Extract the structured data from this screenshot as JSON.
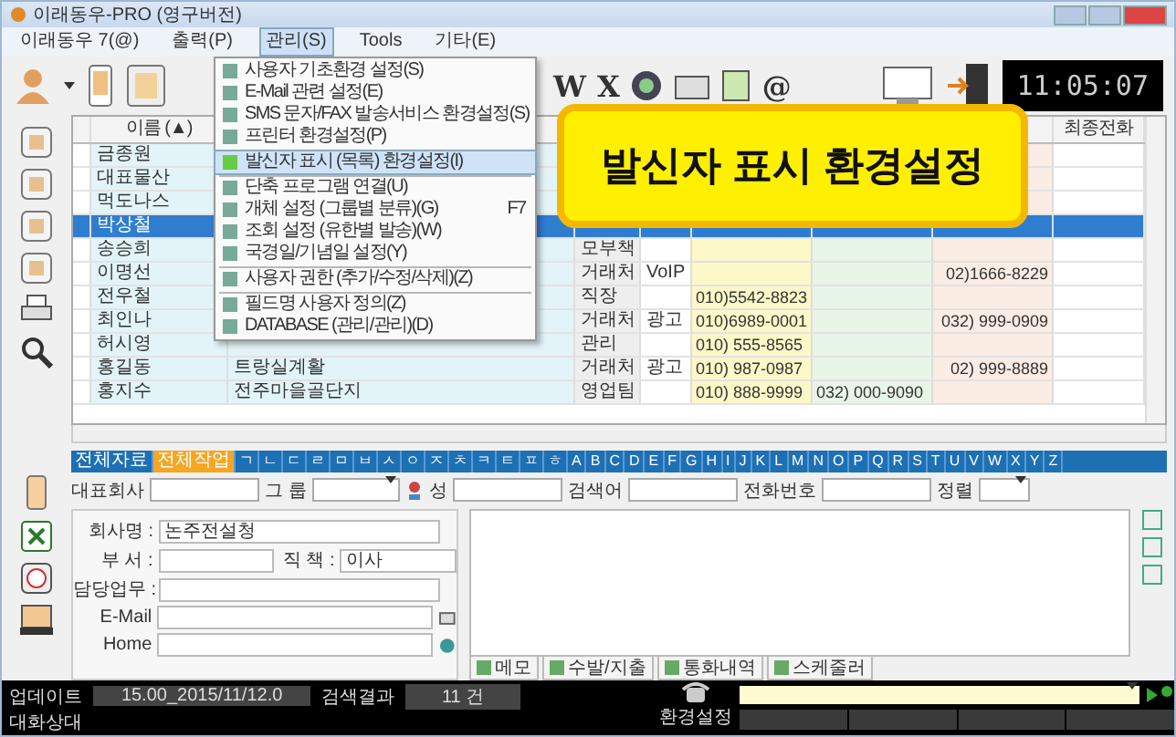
{
  "window": {
    "title": "이래동우-PRO (영구버전)"
  },
  "menu_bar": [
    {
      "label": "이래동우 7(@)",
      "selected": false
    },
    {
      "label": "출력(P)",
      "selected": false
    },
    {
      "label": "관리(S)",
      "selected": true
    },
    {
      "label": "Tools",
      "selected": false
    },
    {
      "label": "기타(E)",
      "selected": false
    }
  ],
  "toolbar": {
    "letters": [
      "W",
      "X"
    ],
    "at": "@",
    "clock": "11:05:07"
  },
  "dropdown": [
    {
      "label": "사용자 기초환경 설정(S)",
      "selected": false
    },
    {
      "label": "E-Mail 관련 설정(E)",
      "selected": false
    },
    {
      "label": "SMS 문자/FAX 발송서비스 환경설정(S)",
      "selected": false
    },
    {
      "label": "프린터 환경설정(P)",
      "selected": false,
      "separator_after": true
    },
    {
      "label": "발신자 표시 (목록) 환경설정(I)",
      "selected": true,
      "separator_after": true
    },
    {
      "label": "단축 프로그램 연결(U)",
      "selected": false
    },
    {
      "label": "개체 설정 (그룹별 분류)(G)",
      "shortcut": "F7",
      "selected": false
    },
    {
      "label": "조회 설정 (유한별 발송)(W)",
      "selected": false
    },
    {
      "label": "국경일/기념일 설정(Y)",
      "selected": false,
      "separator_after": true
    },
    {
      "label": "사용자 권한 (추가/수정/삭제)(Z)",
      "selected": false,
      "separator_after": true
    },
    {
      "label": "필드명 사용자 정의(Z)",
      "selected": false
    },
    {
      "label": "DATABASE (관리/관리)(D)",
      "selected": false
    }
  ],
  "callout": "발신자 표시 환경설정",
  "table": {
    "name_header": "이름 (▲)",
    "last_header": "최종전화",
    "rows": [
      {
        "name": "금종원",
        "selected": false
      },
      {
        "name": "대표물산",
        "selected": false
      },
      {
        "name": "먹도나스",
        "selected": false
      },
      {
        "name": "박상철",
        "selected": true
      },
      {
        "name": "송승희",
        "position": "모부책",
        "selected": false
      },
      {
        "name": "이명선",
        "position": "거래처",
        "type": "VoIP",
        "office": "02)1666-8229",
        "selected": false
      },
      {
        "name": "전우철",
        "position": "직장",
        "mobile": "010)5542-8823",
        "selected": false
      },
      {
        "name": "최인나",
        "position": "거래처",
        "type": "광고",
        "mobile": "010)6989-0001",
        "office": "032) 999-0909",
        "selected": false
      },
      {
        "name": "허시영",
        "position": "관리",
        "mobile": "010) 555-8565",
        "selected": false
      },
      {
        "name": "홍길동",
        "company": "트랑실계활",
        "position": "거래처",
        "type": "광고",
        "mobile": "010) 987-0987",
        "office": "02) 999-8889",
        "selected": false
      },
      {
        "name": "홍지수",
        "company": "전주마을골단지",
        "position": "영업팀",
        "mobile": "010) 888-9999",
        "phone2": "032) 000-9090",
        "selected": false
      }
    ]
  },
  "index_bar": [
    {
      "label": "전체자료",
      "selected": false
    },
    {
      "label": "전체작업",
      "selected": true
    },
    {
      "label": "ㄱ",
      "selected": false
    },
    {
      "label": "ㄴ",
      "selected": false
    },
    {
      "label": "ㄷ",
      "selected": false
    },
    {
      "label": "ㄹ",
      "selected": false
    },
    {
      "label": "ㅁ",
      "selected": false
    },
    {
      "label": "ㅂ",
      "selected": false
    },
    {
      "label": "ㅅ",
      "selected": false
    },
    {
      "label": "ㅇ",
      "selected": false
    },
    {
      "label": "ㅈ",
      "selected": false
    },
    {
      "label": "ㅊ",
      "selected": false
    },
    {
      "label": "ㅋ",
      "selected": false
    },
    {
      "label": "ㅌ",
      "selected": false
    },
    {
      "label": "ㅍ",
      "selected": false
    },
    {
      "label": "ㅎ",
      "selected": false
    },
    {
      "label": "A",
      "selected": false
    },
    {
      "label": "B",
      "selected": false
    },
    {
      "label": "C",
      "selected": false
    },
    {
      "label": "D",
      "selected": false
    },
    {
      "label": "E",
      "selected": false
    },
    {
      "label": "F",
      "selected": false
    },
    {
      "label": "G",
      "selected": false
    },
    {
      "label": "H",
      "selected": false
    },
    {
      "label": "I",
      "selected": false
    },
    {
      "label": "J",
      "selected": false
    },
    {
      "label": "K",
      "selected": false
    },
    {
      "label": "L",
      "selected": false
    },
    {
      "label": "M",
      "selected": false
    },
    {
      "label": "N",
      "selected": false
    },
    {
      "label": "O",
      "selected": false
    },
    {
      "label": "P",
      "selected": false
    },
    {
      "label": "Q",
      "selected": false
    },
    {
      "label": "R",
      "selected": false
    },
    {
      "label": "S",
      "selected": false
    },
    {
      "label": "T",
      "selected": false
    },
    {
      "label": "U",
      "selected": false
    },
    {
      "label": "V",
      "selected": false
    },
    {
      "label": "W",
      "selected": false
    },
    {
      "label": "X",
      "selected": false
    },
    {
      "label": "Y",
      "selected": false
    },
    {
      "label": "Z",
      "selected": false
    }
  ],
  "search_row": [
    {
      "label": "대표회사",
      "kind": "text"
    },
    {
      "label": "그 룹",
      "kind": "select"
    },
    {
      "kind": "select-icon"
    },
    {
      "label": "성",
      "kind": "text"
    },
    {
      "label": "검색어",
      "kind": "text"
    },
    {
      "label": "전화번호",
      "kind": "text"
    },
    {
      "label": "정렬",
      "kind": "small-select"
    }
  ],
  "form": [
    [
      {
        "label": "회사명 :",
        "value": "논주전설청"
      }
    ],
    [
      {
        "label": "부 서 :"
      },
      {
        "label": "직 책 :",
        "value": "이사"
      }
    ],
    [
      {
        "label": "담당업무 :"
      }
    ],
    [
      {
        "label": "E-Mail"
      }
    ],
    [
      {
        "label": "Home"
      }
    ]
  ],
  "bottom_tabs": [
    {
      "label": "메모",
      "selected": false
    },
    {
      "label": "수발/지출",
      "selected": false
    },
    {
      "label": "통화내역",
      "selected": false
    },
    {
      "label": "스케줄러",
      "selected": false
    }
  ],
  "status_bar": {
    "update_label": "업데이트",
    "update_value": "15.00_2015/11/12.0",
    "result_label": "검색결과",
    "result_value": "11 건",
    "chat_label": "대화상대",
    "phone_label": "환경설정"
  }
}
